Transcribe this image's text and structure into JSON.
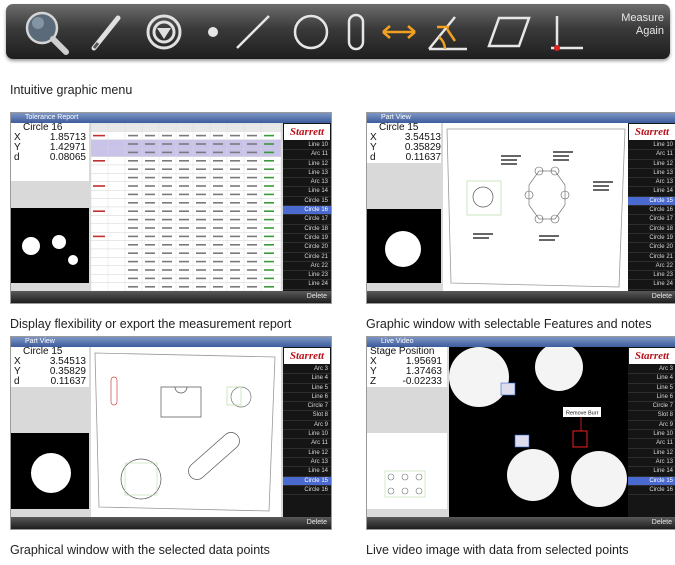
{
  "toolbar": {
    "tools": [
      {
        "name": "magnifier-tool-icon"
      },
      {
        "name": "pen-tool-icon"
      },
      {
        "name": "target-tool-icon"
      },
      {
        "name": "point-tool-icon"
      },
      {
        "name": "line-tool-icon"
      },
      {
        "name": "circle-tool-icon"
      },
      {
        "name": "slot-tool-icon"
      },
      {
        "name": "distance-tool-icon"
      },
      {
        "name": "angle-tool-icon"
      },
      {
        "name": "parallelogram-tool-icon"
      },
      {
        "name": "perpendicular-tool-icon"
      }
    ],
    "measure_label_1": "Measure",
    "measure_label_2": "Again",
    "accent": "#f2a020"
  },
  "captions": {
    "menu": "Intuitive graphic menu",
    "tolerance": "Display flexibility or export the measurement report",
    "partview": "Graphic window with selectable Features and notes",
    "graphical": "Graphical window with the selected data points",
    "video": "Live video image with data from selected points"
  },
  "brand": "Starrett",
  "delete_label": "Delete",
  "shots": {
    "tolerance": {
      "title": "Tolerance Report",
      "feature": "Circle 16",
      "x": "1.85713",
      "y": "1.42971",
      "d": "0.08065",
      "features": [
        "Line 10",
        "Arc 11",
        "Line 12",
        "Line 13",
        "Arc 13",
        "Line 14",
        "Circle 15",
        "Circle 16",
        "Circle 17",
        "Circle 18",
        "Circle 19",
        "Circle 20",
        "Circle 21",
        "Arc 22",
        "Line 23",
        "Line 24"
      ],
      "selected": 7
    },
    "partview": {
      "title": "Part View",
      "feature": "Circle 15",
      "x": "3.54513",
      "y": "0.35829",
      "d": "0.11637",
      "features": [
        "Line 10",
        "Arc 11",
        "Line 12",
        "Line 13",
        "Arc 13",
        "Line 14",
        "Circle 15",
        "Circle 16",
        "Circle 17",
        "Circle 18",
        "Circle 19",
        "Circle 20",
        "Circle 21",
        "Arc 22",
        "Line 23",
        "Line 24"
      ],
      "selected": 6
    },
    "graphical": {
      "title": "Part View",
      "feature": "Circle 15",
      "x": "3.54513",
      "y": "0.35829",
      "d": "0.11637",
      "features": [
        "Arc 3",
        "Line 4",
        "Line 5",
        "Line 6",
        "Circle 7",
        "Slot 8",
        "Arc 9",
        "Line 10",
        "Arc 11",
        "Line 12",
        "Arc 13",
        "Line 14",
        "Circle 15",
        "Circle 16"
      ],
      "selected": 12
    },
    "video": {
      "title": "Live Video",
      "feature": "Stage Position",
      "x": "1.95691",
      "y": "1.37463",
      "z": "-0.02233",
      "callout": "Remove Burr",
      "features": [
        "Arc 3",
        "Line 4",
        "Line 5",
        "Line 6",
        "Circle 7",
        "Slot 8",
        "Arc 9",
        "Line 10",
        "Arc 11",
        "Line 12",
        "Arc 13",
        "Line 14",
        "Circle 15",
        "Circle 16"
      ],
      "selected": 12
    }
  }
}
